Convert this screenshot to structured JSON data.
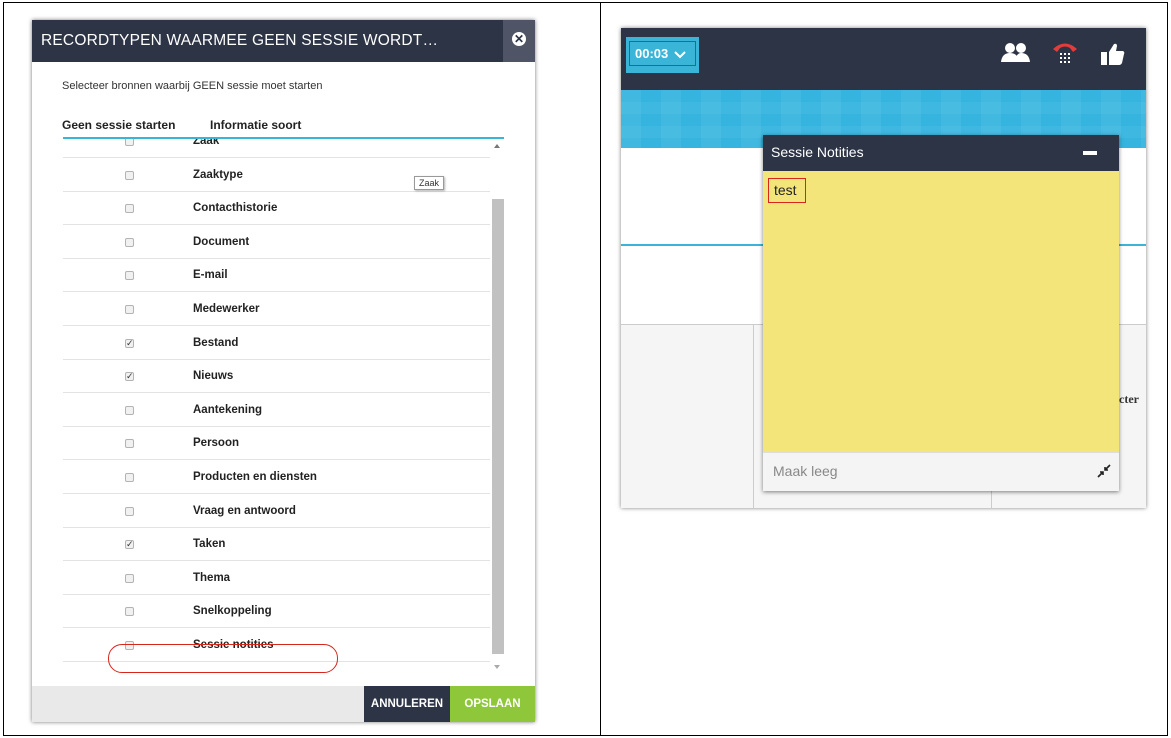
{
  "dialog": {
    "title": "RECORDTYPEN WAARMEE GEEN SESSIE WORDT…",
    "close_icon": "close-circle-icon",
    "subtitle": "Selecteer bronnen waarbij GEEN sessie moet starten",
    "col_no_session": "Geen sessie starten",
    "col_info_type": "Informatie soort",
    "tooltip": "Zaak",
    "rows": [
      {
        "label": "Zaak",
        "checked": false
      },
      {
        "label": "Zaaktype",
        "checked": false
      },
      {
        "label": "Contacthistorie",
        "checked": false
      },
      {
        "label": "Document",
        "checked": false
      },
      {
        "label": "E-mail",
        "checked": false
      },
      {
        "label": "Medewerker",
        "checked": false
      },
      {
        "label": "Bestand",
        "checked": true
      },
      {
        "label": "Nieuws",
        "checked": true
      },
      {
        "label": "Aantekening",
        "checked": false
      },
      {
        "label": "Persoon",
        "checked": false
      },
      {
        "label": "Producten en diensten",
        "checked": false
      },
      {
        "label": "Vraag en antwoord",
        "checked": false
      },
      {
        "label": "Taken",
        "checked": true
      },
      {
        "label": "Thema",
        "checked": false
      },
      {
        "label": "Snelkoppeling",
        "checked": false
      },
      {
        "label": "Sessie notities",
        "checked": false
      }
    ],
    "cancel_label": "ANNULEREN",
    "save_label": "OPSLAAN"
  },
  "app": {
    "timer": "00:03",
    "partial_text": "acter",
    "icons": [
      "people-icon",
      "phone-icon",
      "thumbs-up-icon"
    ],
    "colors": {
      "navy": "#2d3446",
      "cyan": "#3ab5d8",
      "green": "#8ec739",
      "note": "#f3e579",
      "highlight": "#d7261c"
    }
  },
  "notes": {
    "title": "Sessie Notities",
    "text": "test",
    "clear_label": "Maak leeg"
  }
}
